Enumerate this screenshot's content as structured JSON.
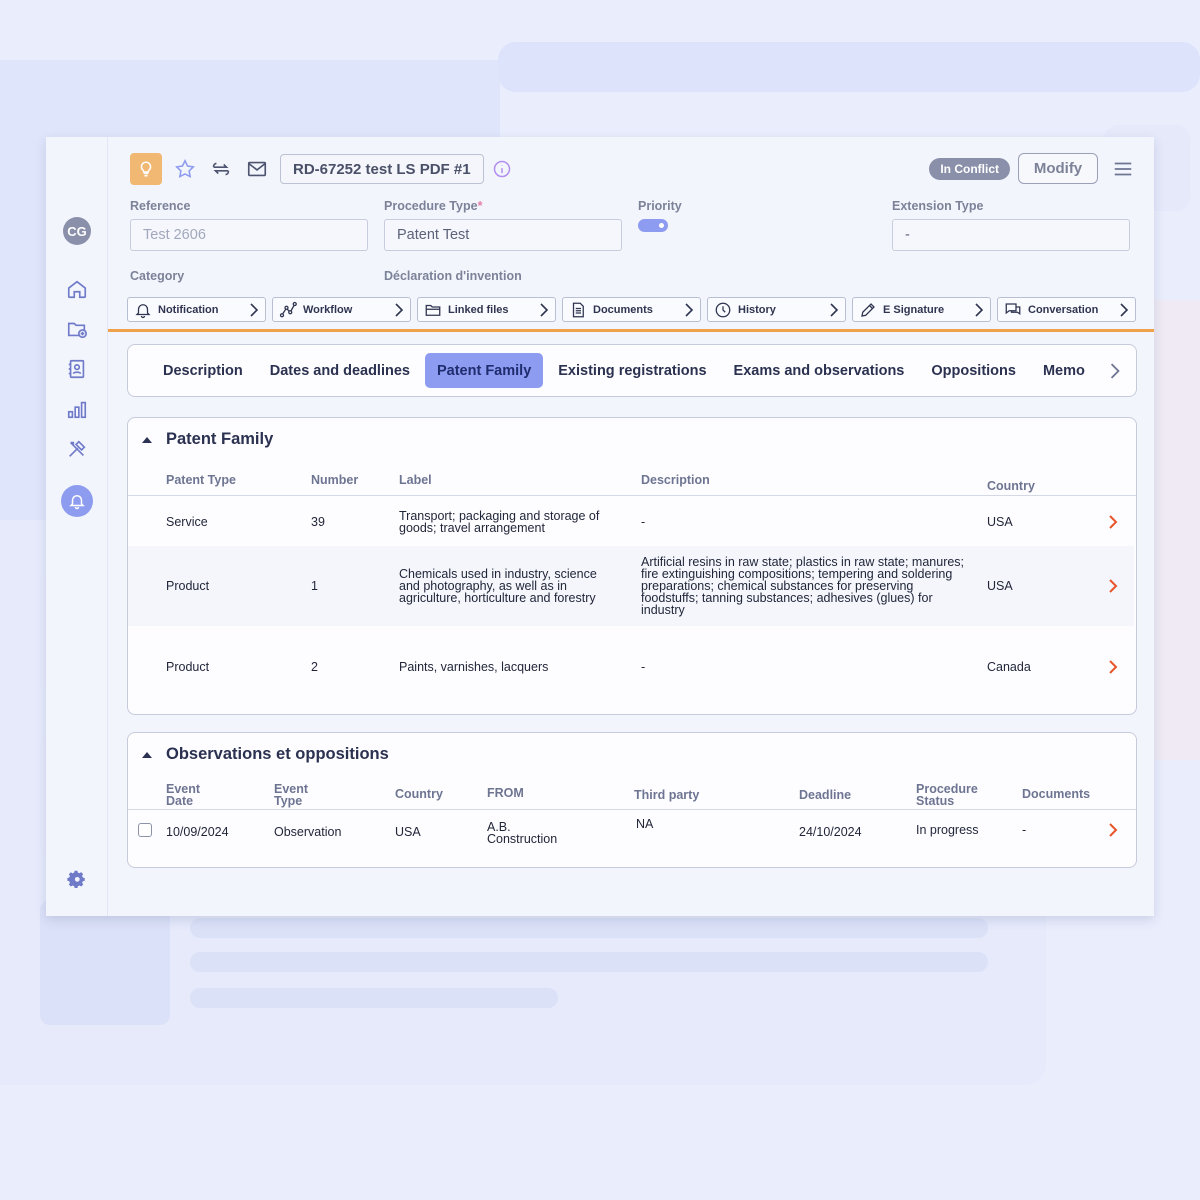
{
  "header": {
    "reference_chip": "RD-67252 test LS PDF  #1",
    "status_badge": "In Conflict",
    "modify_label": "Modify"
  },
  "user": {
    "initials": "CG"
  },
  "fields": {
    "reference": {
      "label": "Reference",
      "value": "Test 2606"
    },
    "procedure_type": {
      "label": "Procedure Type",
      "required_mark": "*",
      "value": "Patent Test"
    },
    "priority": {
      "label": "Priority",
      "enabled": true
    },
    "extension_type": {
      "label": "Extension Type",
      "value": "-"
    },
    "category": {
      "label": "Category"
    },
    "declaration": {
      "label": "Déclaration d'invention"
    }
  },
  "shortcuts": [
    {
      "label": "Notification",
      "icon": "bell-icon"
    },
    {
      "label": "Workflow",
      "icon": "workflow-icon"
    },
    {
      "label": "Linked files",
      "icon": "folder-icon"
    },
    {
      "label": "Documents",
      "icon": "document-icon"
    },
    {
      "label": "History",
      "icon": "clock-icon"
    },
    {
      "label": "E Signature",
      "icon": "pen-icon"
    },
    {
      "label": "Conversation",
      "icon": "chat-icon"
    }
  ],
  "tabs": [
    {
      "label": "Description",
      "active": false
    },
    {
      "label": "Dates and deadlines",
      "active": false
    },
    {
      "label": "Patent Family",
      "active": true
    },
    {
      "label": "Existing registrations",
      "active": false
    },
    {
      "label": "Exams and observations",
      "active": false
    },
    {
      "label": "Oppositions",
      "active": false
    },
    {
      "label": "Memo",
      "active": false
    }
  ],
  "patent_family": {
    "title": "Patent Family",
    "columns": [
      "Patent Type",
      "Number",
      "Label",
      "Description",
      "Country"
    ],
    "rows": [
      {
        "type": "Service",
        "number": "39",
        "label": "Transport; packaging and storage of goods; travel arrangement",
        "description": "-",
        "country": "USA"
      },
      {
        "type": "Product",
        "number": "1",
        "label": "Chemicals used in industry, science and photography, as well as in agriculture, horticulture and forestry",
        "description": "Artificial resins in raw state; plastics in raw state; manures; fire extinguishing compositions; tempering and soldering preparations; chemical substances for preserving foodstuffs; tanning substances; adhesives (glues) for industry",
        "country": "USA"
      },
      {
        "type": "Product",
        "number": "2",
        "label": "Paints, varnishes, lacquers",
        "description": "-",
        "country": "Canada"
      }
    ]
  },
  "observations": {
    "title": "Observations et oppositions",
    "columns": [
      "Event Date",
      "Event Type",
      "Country",
      "FROM",
      "Third party",
      "Deadline",
      "Procedure Status",
      "Documents"
    ],
    "rows": [
      {
        "event_date": "10/09/2024",
        "event_type": "Observation",
        "country": "USA",
        "from": "A.B. Construction",
        "third_party": "NA",
        "deadline": "24/10/2024",
        "status": "In progress",
        "documents": "-"
      }
    ]
  },
  "colors": {
    "accent": "#8d9bf0",
    "orange": "#f0a24a",
    "arrow": "#e8552a",
    "idea": "#f0b873"
  }
}
